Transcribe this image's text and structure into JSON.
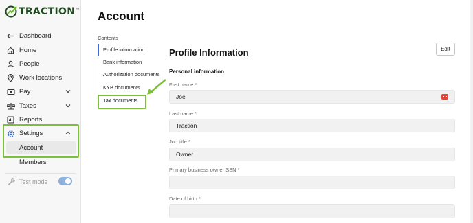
{
  "app": {
    "logo_text": "TRACTION",
    "logo_tm": "™"
  },
  "sidebar": {
    "items": [
      {
        "label": "Dashboard",
        "icon": "arrow-left-icon"
      },
      {
        "label": "Home",
        "icon": "home-icon"
      },
      {
        "label": "People",
        "icon": "user-icon"
      },
      {
        "label": "Work locations",
        "icon": "location-pin-icon"
      },
      {
        "label": "Pay",
        "icon": "money-icon",
        "expandable": true
      },
      {
        "label": "Taxes",
        "icon": "scale-icon",
        "expandable": true
      },
      {
        "label": "Reports",
        "icon": "report-icon"
      },
      {
        "label": "Settings",
        "icon": "gear-icon",
        "expanded": true
      }
    ],
    "settings_sub_items": [
      {
        "label": "Account",
        "active": true
      },
      {
        "label": "Members",
        "active": false
      }
    ],
    "test_mode": {
      "label": "Test mode",
      "enabled": true
    }
  },
  "main": {
    "page_title": "Account",
    "contents": {
      "label": "Contents",
      "items": [
        {
          "label": "Profile information",
          "active": true
        },
        {
          "label": "Bank information",
          "active": false
        },
        {
          "label": "Authorization documents",
          "active": false
        },
        {
          "label": "KYB documents",
          "active": false
        },
        {
          "label": "Tax documents",
          "active": false,
          "highlighted": true
        }
      ]
    },
    "profile": {
      "title": "Profile Information",
      "edit_label": "Edit",
      "subsection": "Personal information",
      "fields": [
        {
          "label": "First name *",
          "value": "Joe"
        },
        {
          "label": "Last name *",
          "value": "Traction"
        },
        {
          "label": "Job title *",
          "value": "Owner"
        },
        {
          "label": "Primary business owner SSN *",
          "value": ""
        },
        {
          "label": "Date of birth *",
          "value": ""
        }
      ]
    }
  },
  "colors": {
    "highlight": "#7bbf3a",
    "accent": "#3d6bd4",
    "logo": "#1f4a1f",
    "toggle": "#8fb0d8"
  }
}
